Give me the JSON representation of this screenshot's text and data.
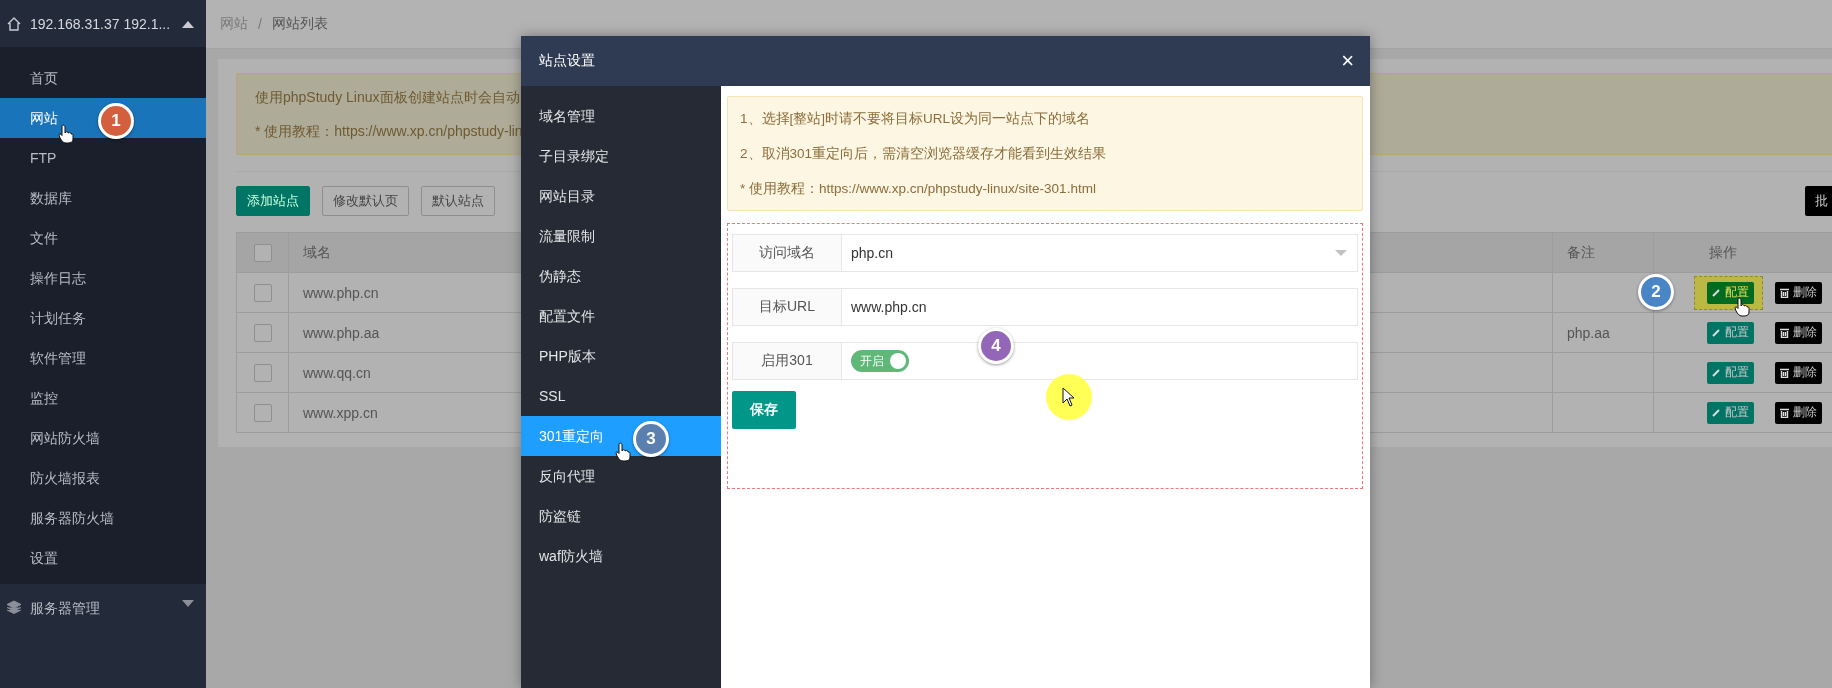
{
  "sidebar": {
    "host": "192.168.31.37 192.1...",
    "expanded": true,
    "items": [
      {
        "label": "首页",
        "selected": false
      },
      {
        "label": "网站",
        "selected": true,
        "callout": {
          "number": "1",
          "color": "#d35f3e"
        }
      },
      {
        "label": "FTP",
        "selected": false
      },
      {
        "label": "数据库",
        "selected": false
      },
      {
        "label": "文件",
        "selected": false
      },
      {
        "label": "操作日志",
        "selected": false
      },
      {
        "label": "计划任务",
        "selected": false
      },
      {
        "label": "软件管理",
        "selected": false
      },
      {
        "label": "监控",
        "selected": false
      },
      {
        "label": "网站防火墙",
        "selected": false
      },
      {
        "label": "防火墙报表",
        "selected": false
      },
      {
        "label": "服务器防火墙",
        "selected": false
      },
      {
        "label": "设置",
        "selected": false
      }
    ],
    "group": {
      "label": "服务器管理",
      "expanded": false
    }
  },
  "breadcrumb": [
    "网站",
    "网站列表"
  ],
  "breadcrumb_separator": "/",
  "notice": [
    "使用phpStudy Linux面板创建站点时会自动",
    "* 使用教程：https://www.xp.cn/phpstudy-lin"
  ],
  "toolbar": [
    {
      "label": "添加站点",
      "kind": "primary"
    },
    {
      "label": "修改默认页",
      "kind": "plain"
    },
    {
      "label": "默认站点",
      "kind": "plain"
    }
  ],
  "batch_button": "批",
  "table": {
    "header_checked": false,
    "columns": [
      "域名",
      "备注",
      "操作"
    ],
    "rows": [
      {
        "checked": false,
        "domain": "www.php.cn",
        "note": "",
        "highlighted": true,
        "callout": {
          "number": "2",
          "color": "#4a86c5"
        },
        "actions": [
          "配置",
          "删除"
        ]
      },
      {
        "checked": false,
        "domain": "www.php.aa",
        "note": "php.aa",
        "highlighted": false,
        "actions": [
          "配置",
          "删除"
        ]
      },
      {
        "checked": false,
        "domain": "www.qq.cn",
        "note": "",
        "highlighted": false,
        "actions": [
          "配置",
          "删除"
        ]
      },
      {
        "checked": false,
        "domain": "www.xpp.cn",
        "note": "",
        "highlighted": false,
        "actions": [
          "配置",
          "删除"
        ]
      }
    ]
  },
  "modal": {
    "title": "站点设置",
    "close": "×",
    "menu": [
      {
        "label": "域名管理",
        "selected": false
      },
      {
        "label": "子目录绑定",
        "selected": false
      },
      {
        "label": "网站目录",
        "selected": false
      },
      {
        "label": "流量限制",
        "selected": false
      },
      {
        "label": "伪静态",
        "selected": false
      },
      {
        "label": "配置文件",
        "selected": false
      },
      {
        "label": "PHP版本",
        "selected": false
      },
      {
        "label": "SSL",
        "selected": false
      },
      {
        "label": "301重定向",
        "selected": true,
        "callout": {
          "number": "3",
          "color": "#5b7fae"
        }
      },
      {
        "label": "反向代理",
        "selected": false
      },
      {
        "label": "防盗链",
        "selected": false
      },
      {
        "label": "waf防火墙",
        "selected": false
      }
    ],
    "notice": [
      "1、选择[整站]时请不要将目标URL设为同一站点下的域名",
      "2、取消301重定向后，需清空浏览器缓存才能看到生效结果",
      "* 使用教程：https://www.xp.cn/phpstudy-linux/site-301.html"
    ],
    "callout": {
      "number": "4",
      "color": "#9466b8"
    },
    "fields": [
      {
        "kind": "select",
        "label": "访问域名",
        "value": "php.cn"
      },
      {
        "kind": "text",
        "label": "目标URL",
        "value": "www.php.cn"
      },
      {
        "kind": "toggle",
        "label": "启用301",
        "on": true,
        "text": "开启"
      }
    ],
    "save": "保存"
  }
}
